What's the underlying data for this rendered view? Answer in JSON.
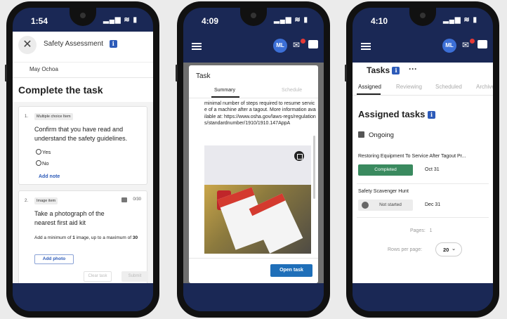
{
  "phone1": {
    "status": {
      "time": "1:54",
      "icons": "▂▄▆ ≋ ▮"
    },
    "header": {
      "title": "Safety Assessment",
      "close_icon": "close-icon",
      "info_icon": "i"
    },
    "user": "May Ochoa",
    "heading": "Complete the task",
    "items": [
      {
        "number": "1.",
        "type": "Multiple choice Item",
        "question": "Confirm that you have read and understand the safety guidelines.",
        "options": [
          "Yes",
          "No"
        ],
        "add_note": "Add note"
      },
      {
        "number": "2.",
        "type": "Image item",
        "counter": "0/30",
        "question": "Take a photograph of the nearest first aid kit",
        "requirement_prefix": "Add a minimum of ",
        "requirement_min": "1",
        "requirement_mid": " image, up to a maximum of ",
        "requirement_max": "30",
        "add_photo": "Add photo"
      }
    ],
    "footer": {
      "clear": "Clear task",
      "submit": "Submit"
    }
  },
  "phone2": {
    "status": {
      "time": "4:09",
      "icons": "▂▄▆ ≋ ▮"
    },
    "avatar": "ML",
    "modal": {
      "title": "Task",
      "tabs": [
        "Summary",
        "Schedule"
      ],
      "active_tab": "Summary",
      "body": "minimal number of steps required to resume service of a machine after a tagout. More information available at: https://www.osha.gov/laws-regs/regulations/standardnumber/1910/1910.147AppA",
      "open_button": "Open task"
    }
  },
  "phone3": {
    "status": {
      "time": "4:10",
      "icons": "▂▄▆ ≋ ▮"
    },
    "avatar": "ML",
    "title": "Tasks",
    "more": "···",
    "tabs": [
      "Assigned",
      "Reviewing",
      "Scheduled",
      "Archive"
    ],
    "active_tab": "Assigned",
    "heading": "Assigned tasks",
    "group": "Ongoing",
    "tasks": [
      {
        "name": "Restoring Equipment To Service After Tagout Pr...",
        "status": "Completed",
        "due": "Oct 31",
        "status_color": "#3a8a5f"
      },
      {
        "name": "Safety Scavenger Hunt",
        "status": "Not started",
        "due": "Dec 31",
        "status_color": "#ececec"
      }
    ],
    "pages_label": "Pages:",
    "pages_value": "1",
    "rows_label": "Rows per page:",
    "rows_value": "20"
  },
  "colors": {
    "navy": "#1a2855",
    "accent": "#2d5bb9",
    "open_button": "#1f6fb9",
    "completed": "#3a8a5f"
  }
}
